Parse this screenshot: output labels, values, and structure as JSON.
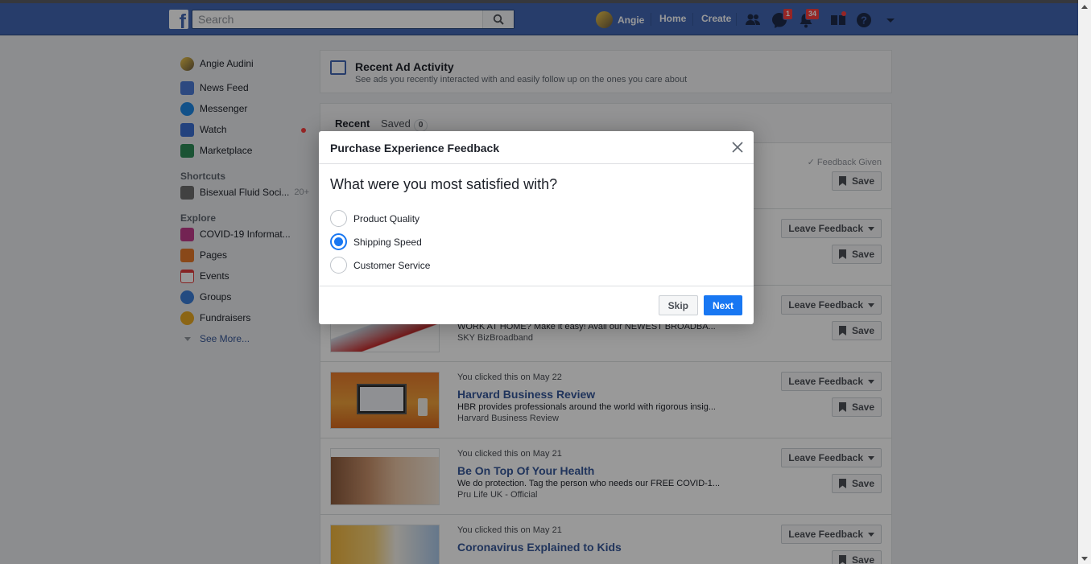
{
  "topbar": {
    "search_placeholder": "Search",
    "user_name": "Angie",
    "home_label": "Home",
    "create_label": "Create",
    "messages_badge": "1",
    "notifications_badge": "34"
  },
  "sidebar": {
    "profile_name": "Angie Audini",
    "items": [
      {
        "label": "News Feed",
        "icon": "news-feed-icon",
        "color": "#4b7bd6"
      },
      {
        "label": "Messenger",
        "icon": "messenger-icon",
        "color": "#1e88e5"
      },
      {
        "label": "Watch",
        "icon": "watch-icon",
        "color": "#3b6ed2"
      },
      {
        "label": "Marketplace",
        "icon": "marketplace-icon",
        "color": "#2e8b57"
      }
    ],
    "shortcuts_heading": "Shortcuts",
    "shortcuts": [
      {
        "label": "Bisexual Fluid Soci...",
        "count": "20+"
      }
    ],
    "explore_heading": "Explore",
    "explore": [
      {
        "label": "COVID-19 Informat...",
        "icon": "covid-shield-icon",
        "color": "#c03b8b"
      },
      {
        "label": "Pages",
        "icon": "flag-icon",
        "color": "#e5792a"
      },
      {
        "label": "Events",
        "icon": "calendar-icon",
        "color": "#e03c3c"
      },
      {
        "label": "Groups",
        "icon": "groups-icon",
        "color": "#3b7dd8"
      },
      {
        "label": "Fundraisers",
        "icon": "heart-icon",
        "color": "#e8a923"
      }
    ],
    "see_more": "See More..."
  },
  "header": {
    "title": "Recent Ad Activity",
    "subtitle": "See ads you recently interacted with and easily follow up on the ones you care about"
  },
  "tabs": {
    "recent": "Recent",
    "saved": "Saved",
    "saved_count": "0"
  },
  "ads": {
    "feedback_given": "Feedback Given",
    "leave_feedback": "Leave Feedback",
    "save": "Save",
    "items": [
      {
        "when": "",
        "title": "",
        "desc": "WORK AT HOME? Make it easy! Avail our NEWEST BROADBA...",
        "source": "SKY BizBroadband"
      },
      {
        "when": "You clicked this on May 22",
        "title": "Harvard Business Review",
        "desc": "HBR provides professionals around the world with rigorous insig...",
        "source": "Harvard Business Review"
      },
      {
        "when": "You clicked this on May 21",
        "title": "Be On Top Of Your Health",
        "desc": "We do protection. Tag the person who needs our FREE COVID-1...",
        "source": "Pru Life UK - Official"
      },
      {
        "when": "You clicked this on May 21",
        "title": "Coronavirus Explained to Kids",
        "desc": "",
        "source": ""
      }
    ]
  },
  "modal": {
    "title": "Purchase Experience Feedback",
    "question": "What were you most satisfied with?",
    "options": [
      "Product Quality",
      "Shipping Speed",
      "Customer Service"
    ],
    "selected": "Shipping Speed",
    "skip": "Skip",
    "next": "Next"
  },
  "colors": {
    "brand": "#4267b2",
    "primary_button": "#1877f2",
    "background": "#e9ebee"
  }
}
